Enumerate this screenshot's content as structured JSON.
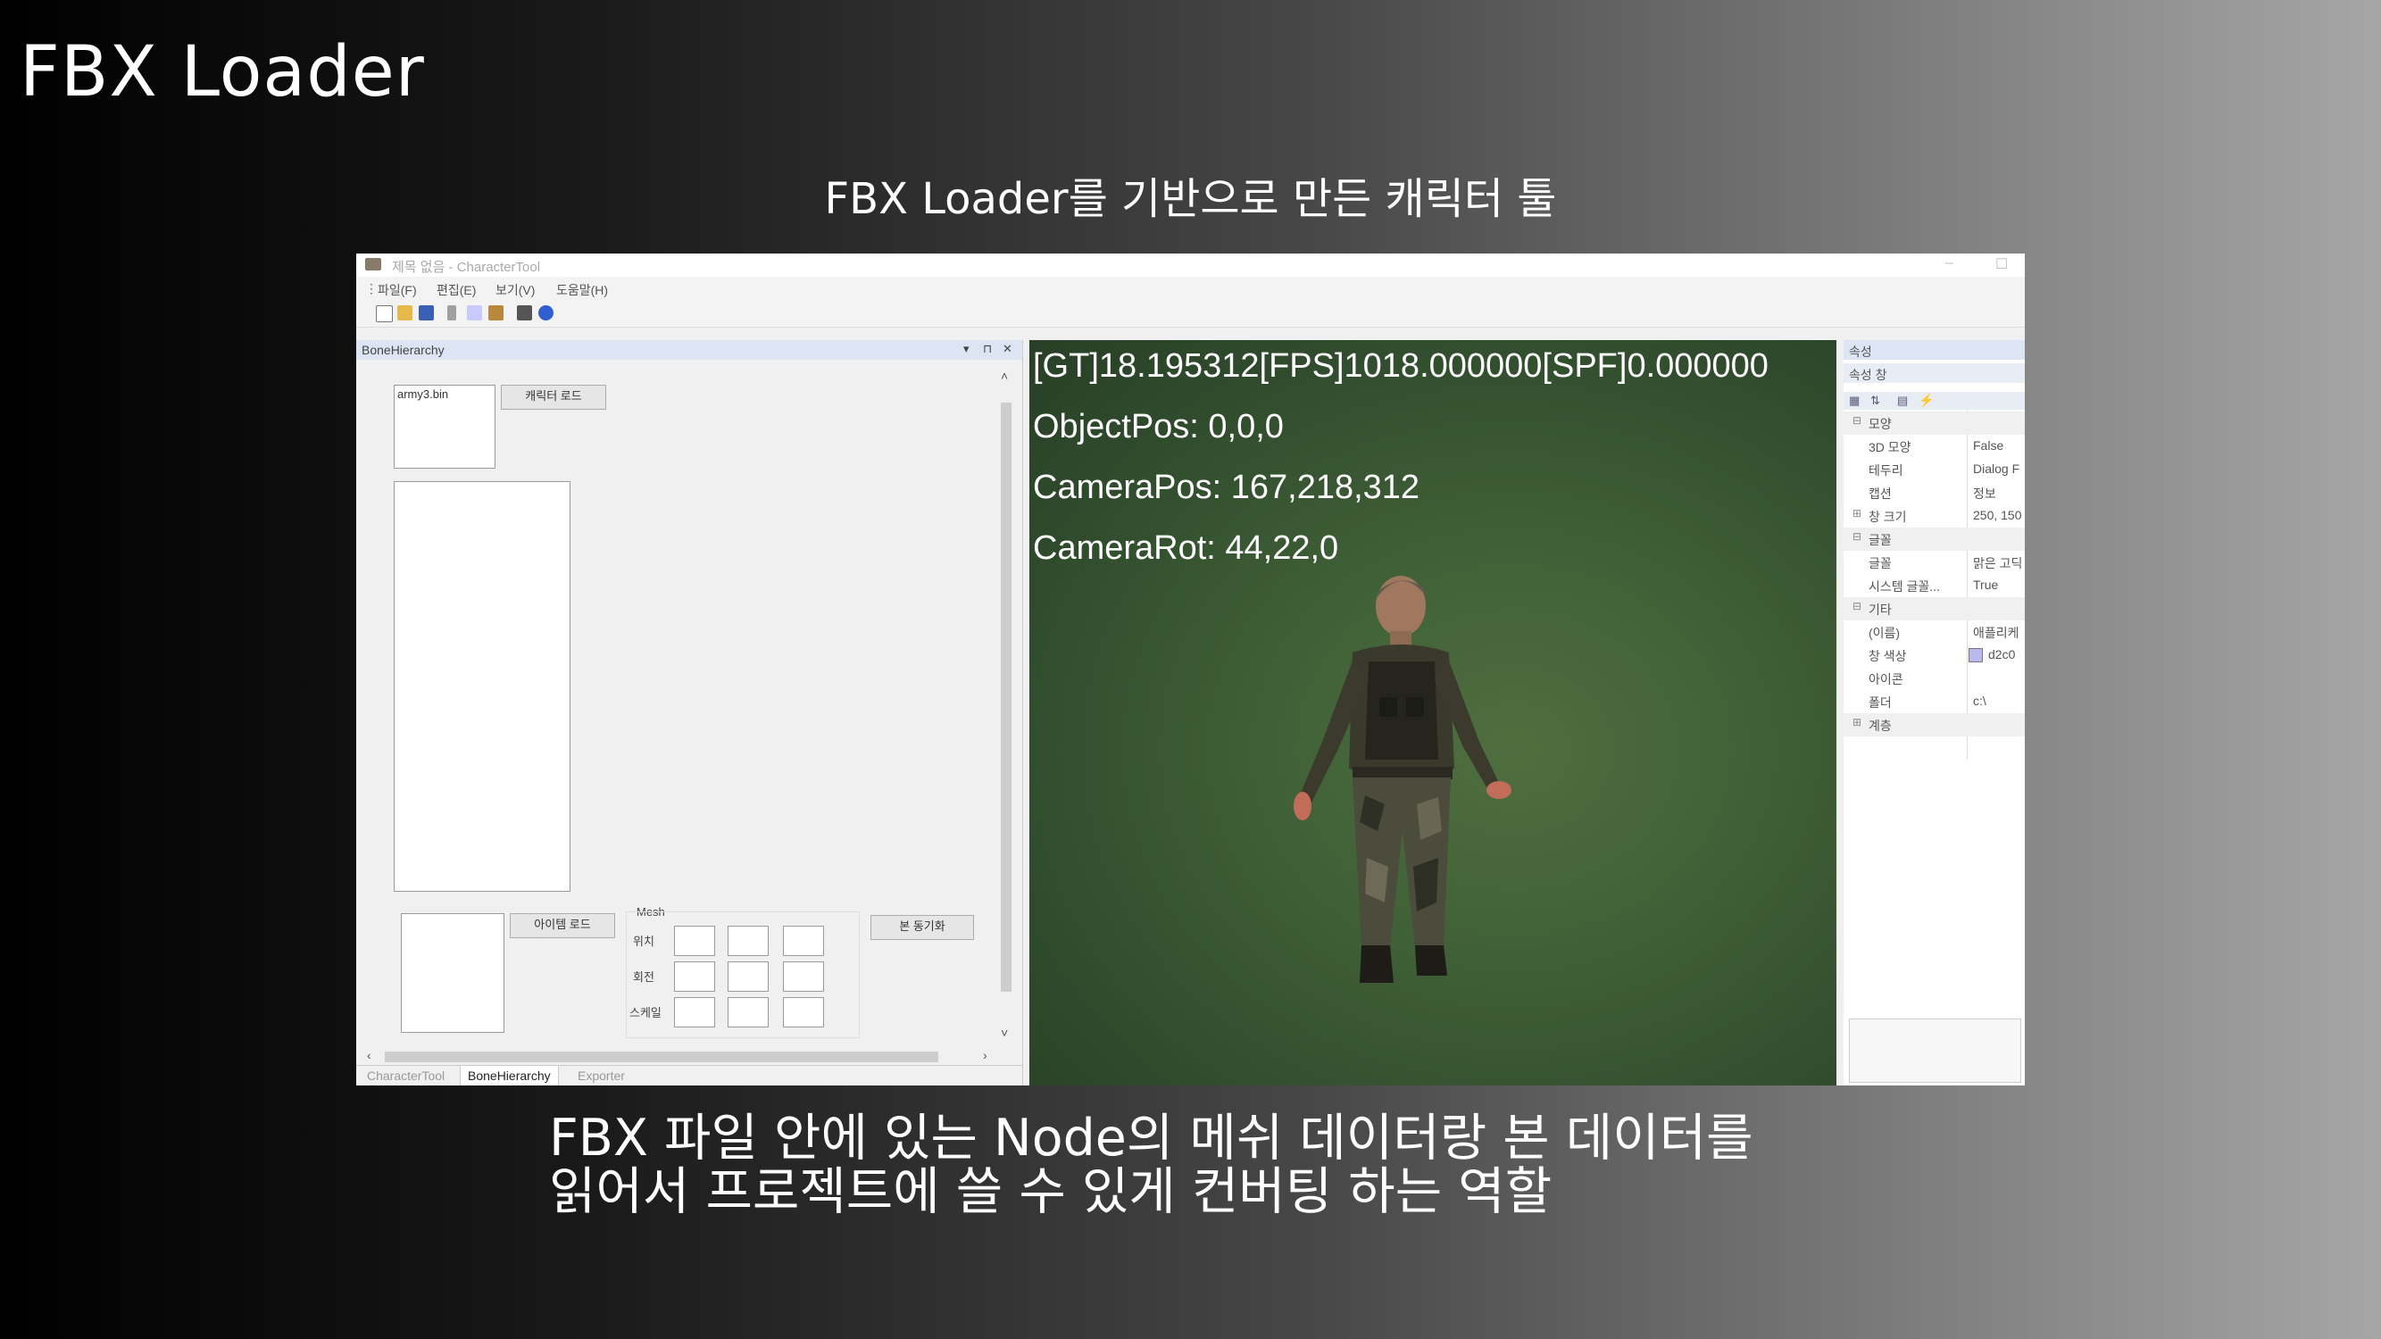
{
  "slide": {
    "title": "FBX Loader",
    "subtitle": "FBX Loader를 기반으로 만든 캐릭터 툴",
    "caption_line1": "FBX 파일 안에 있는 Node의 메쉬 데이터랑 본 데이터를",
    "caption_line2": "읽어서 프로젝트에 쓸 수 있게 컨버팅 하는 역할"
  },
  "app": {
    "window_title": "제목 없음 - CharacterTool",
    "menu": [
      "파일(F)",
      "편집(E)",
      "보기(V)",
      "도움말(H)"
    ],
    "toolbar_icons": [
      "new-file-icon",
      "open-folder-icon",
      "save-icon",
      "cut-icon",
      "copy-icon",
      "paste-icon",
      "print-icon",
      "help-icon"
    ]
  },
  "bone_panel": {
    "title": "BoneHierarchy",
    "file_item": "army3.bin",
    "load_character_button": "캐릭터 로드",
    "load_item_button": "아이템 로드",
    "mesh_group": "Mesh",
    "mesh_rows": [
      "위치",
      "회전",
      "스케일"
    ],
    "bone_sync_button": "본 동기화",
    "tabs": [
      "CharacterTool",
      "BoneHierarchy",
      "Exporter"
    ],
    "active_tab": "BoneHierarchy"
  },
  "viewport": {
    "stats_line": "[GT]18.195312[FPS]1018.000000[SPF]0.000000",
    "object_pos": "ObjectPos: 0,0,0",
    "camera_pos": "CameraPos: 167,218,312",
    "camera_rot": "CameraRot: 44,22,0"
  },
  "properties": {
    "header": "속성",
    "subheader": "속성 창",
    "rows": [
      {
        "type": "category",
        "expand": "⊟",
        "key": "모양",
        "value": ""
      },
      {
        "type": "prop",
        "expand": "",
        "key": "3D 모양",
        "value": "False"
      },
      {
        "type": "prop",
        "expand": "",
        "key": "테두리",
        "value": "Dialog F"
      },
      {
        "type": "prop",
        "expand": "",
        "key": "캡션",
        "value": "정보"
      },
      {
        "type": "prop",
        "expand": "⊞",
        "key": "창 크기",
        "value": "250, 150"
      },
      {
        "type": "category",
        "expand": "⊟",
        "key": "글꼴",
        "value": ""
      },
      {
        "type": "prop",
        "expand": "",
        "key": "글꼴",
        "value": "맑은 고딕"
      },
      {
        "type": "prop",
        "expand": "",
        "key": "시스템 글꼴...",
        "value": "True"
      },
      {
        "type": "category",
        "expand": "⊟",
        "key": "기타",
        "value": ""
      },
      {
        "type": "prop",
        "expand": "",
        "key": "(이름)",
        "value": "애플리케"
      },
      {
        "type": "prop",
        "expand": "",
        "key": "창 색상",
        "value": "d2c0"
      },
      {
        "type": "prop",
        "expand": "",
        "key": "아이콘",
        "value": ""
      },
      {
        "type": "prop",
        "expand": "",
        "key": "폴더",
        "value": "c:\\"
      },
      {
        "type": "category",
        "expand": "⊞",
        "key": "계층",
        "value": ""
      }
    ],
    "color_swatch": "#b9b9ee"
  }
}
